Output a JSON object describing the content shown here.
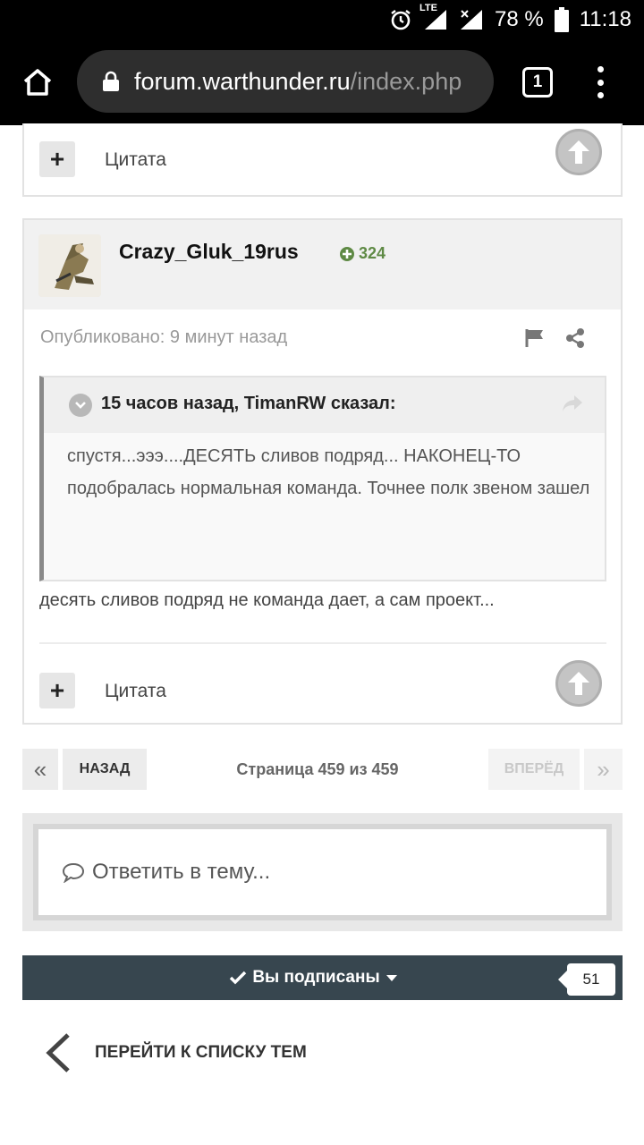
{
  "status_bar": {
    "network": "LTE",
    "battery": "78 %",
    "time": "11:18",
    "icons": [
      "alarm-icon",
      "signal-icon",
      "signal-off-icon",
      "battery-icon"
    ]
  },
  "browser": {
    "url_domain": "forum.warthunder.ru",
    "url_path": "/index.php",
    "tab_count": "1"
  },
  "previous_post": {
    "quote_label": "Цитата"
  },
  "post": {
    "author": "Crazy_Gluk_19rus",
    "reputation": "324",
    "posted": "Опубликовано: 9 минут назад",
    "quote": {
      "header": "15 часов назад, TimanRW сказал:",
      "body": "спустя...эээ....ДЕСЯТЬ сливов подряд... НАКОНЕЦ-ТО подобралась нормальная команда. Точнее полк звеном зашел"
    },
    "text": "десять сливов подряд не команда дает, а сам проект...",
    "quote_label": "Цитата"
  },
  "pagination": {
    "first": "«",
    "prev": "НАЗАД",
    "info": "Страница 459 из 459",
    "next": "ВПЕРЁД",
    "last": "»"
  },
  "reply": {
    "placeholder": "Ответить в тему..."
  },
  "follow": {
    "label": "Вы подписаны",
    "count": "51"
  },
  "back": {
    "label": "ПЕРЕЙТИ К СПИСКУ ТЕМ"
  },
  "colors": {
    "status_bg": "#000000",
    "follow_bg": "#37464f",
    "rep_green": "#5f8a45"
  }
}
